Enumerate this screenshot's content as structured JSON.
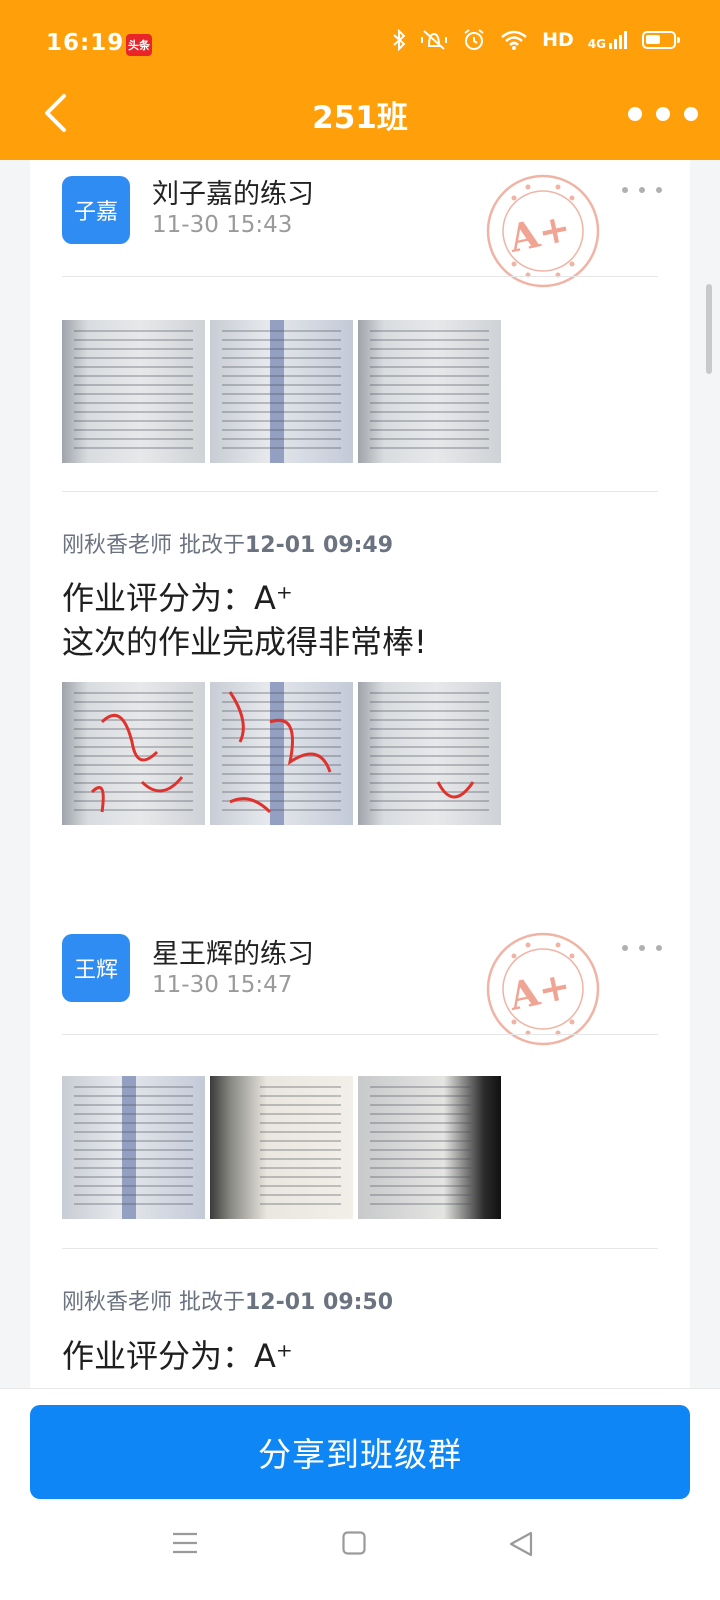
{
  "status_bar": {
    "time": "16:19",
    "app_badge": "头条",
    "hd": "HD",
    "network": "4G",
    "battery_level": 0.55
  },
  "header": {
    "title": "251班",
    "back_icon": "chevron-left-icon",
    "more_icon": "more-dots-icon",
    "bg_color": "#ff9f0a"
  },
  "posts": [
    {
      "avatar": "子嘉",
      "title": "刘子嘉的练习",
      "time": "11-30 15:43",
      "stamp": "A+",
      "graded_by_prefix": "刚秋香老师 批改于",
      "graded_at": "12-01 09:49",
      "comment_line1": "作业评分为：A⁺",
      "comment_line2": "这次的作业完成得非常棒!"
    },
    {
      "avatar": "王辉",
      "title": "星王辉的练习",
      "time": "11-30 15:47",
      "stamp": "A+",
      "graded_by_prefix": "刚秋香老师 批改于",
      "graded_at": "12-01 09:50",
      "comment_line1": "作业评分为：A⁺"
    }
  ],
  "share_button": "分享到班级群",
  "accent_color": "#0f86f5",
  "avatar_color": "#2f8cf2"
}
